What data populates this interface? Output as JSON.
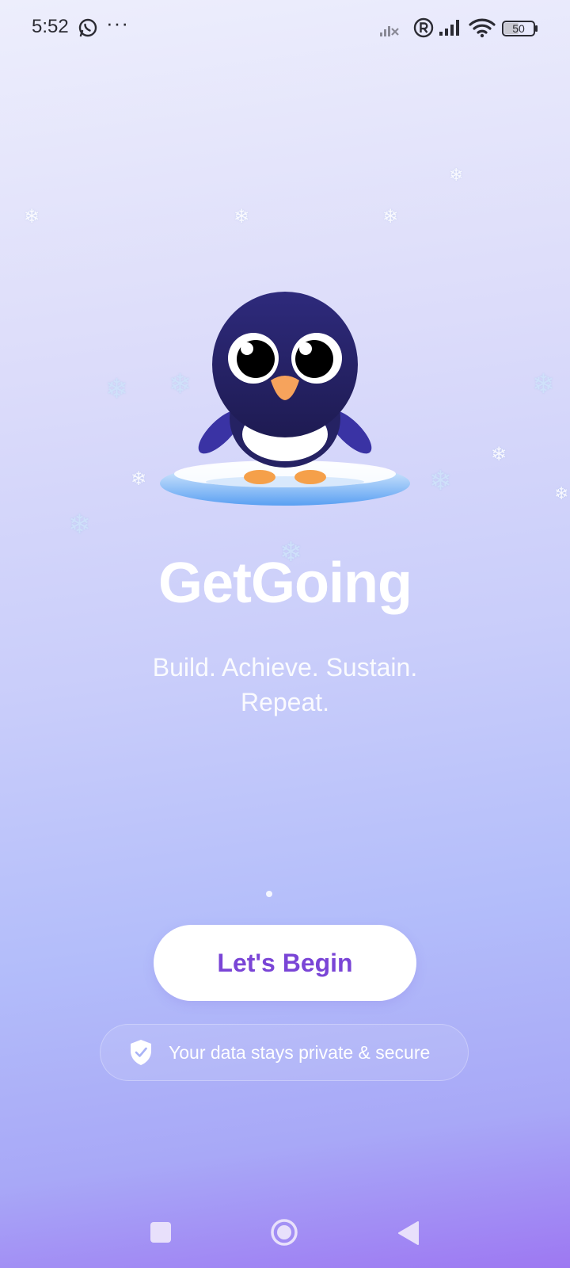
{
  "status_bar": {
    "time": "5:52",
    "battery": "50",
    "icons": [
      "whatsapp-icon",
      "more-dots-icon",
      "no-signal-icon",
      "registered-icon",
      "signal-icon",
      "wifi-icon",
      "battery-icon"
    ],
    "more": "···"
  },
  "decor": {
    "flake": "❄"
  },
  "app": {
    "title": "GetGoing",
    "tagline": "Build. Achieve. Sustain. Repeat.",
    "begin_label": "Let's Begin",
    "privacy_label": "Your data stays private & secure"
  },
  "colors": {
    "accent": "#7a45d6",
    "penguin_body": "#2a2772",
    "gradient_top": "#edeefc",
    "gradient_bottom": "#9d78f2"
  }
}
